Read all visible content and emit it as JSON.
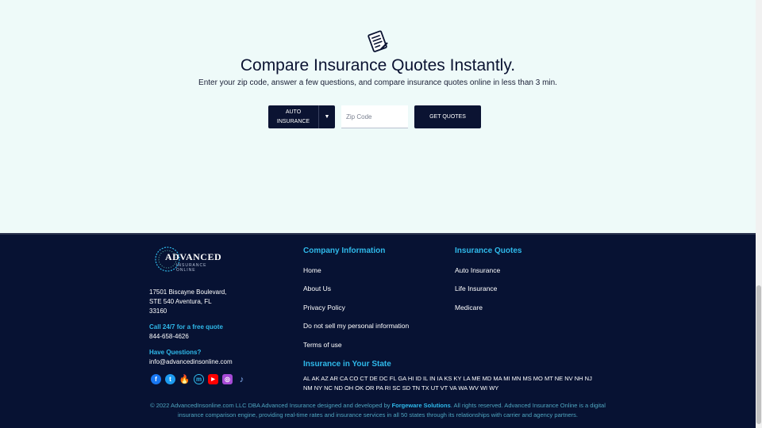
{
  "hero": {
    "icon": "checklist-icon",
    "title": "Compare Insurance Quotes Instantly.",
    "subtitle": "Enter your zip code, answer a few questions, and compare insurance quotes online in less than 3 min.",
    "insurance_type_line1": "AUTO",
    "insurance_type_line2": "INSURANCE",
    "zip_placeholder": "Zip Code",
    "get_quotes_label": "GET QUOTES"
  },
  "footer": {
    "logo_word": "ADVANCED",
    "logo_tag": "INSURANCE ONLINE",
    "address_line1": "17501 Biscayne Boulevard,",
    "address_line2": "STE 540 Aventura, FL",
    "address_line3": "33160",
    "call_label": "Call 24/7 for a free quote",
    "phone": "844-658-4626",
    "questions_label": "Have Questions?",
    "email": "info@advancedinsonline.com",
    "socials": [
      "facebook-icon",
      "twitter-icon",
      "tinder-icon",
      "messenger-icon",
      "youtube-icon",
      "instagram-icon",
      "tiktok-icon"
    ],
    "company": {
      "heading": "Company Information",
      "links": [
        "Home",
        "About Us",
        "Privacy Policy",
        "Do not sell my personal information",
        "Terms of use"
      ]
    },
    "quotes": {
      "heading": "Insurance Quotes",
      "links": [
        "Auto Insurance",
        "Life Insurance",
        "Medicare"
      ]
    },
    "states": {
      "heading": "Insurance in Your State",
      "line1": "AL AK AZ AR CA CO CT DE DC FL GA HI ID IL IN IA KS KY LA ME MD MA MI MN MS MO MT NE NV NH NJ",
      "line2": "NM NY NC ND OH OK OR PA RI SC SD TN TX UT VT VA WA WV WI WY"
    },
    "copyright_pre": "© 2022 AdvancedInsonline.com LLC DBA Advanced Insurance designed and developed by ",
    "copyright_brand": "Forgeware Solutions",
    "copyright_post": ". All rights reserved. Advanced Insurance Online is a digital insurance comparison engine, providing real-time rates and insurance services in all 50 states through its relationships with carrier and agency partners."
  },
  "colors": {
    "navy": "#0b1332",
    "footer_bg": "#071233",
    "accent": "#2fb9ea",
    "hero_bg": "#eefaf9"
  }
}
